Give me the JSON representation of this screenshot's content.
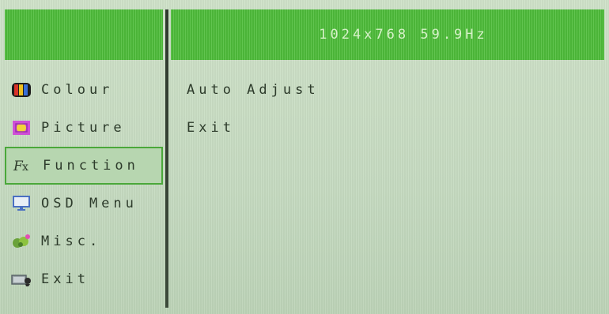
{
  "header": {
    "resolution": "1024x768 59.9Hz"
  },
  "menu": {
    "items": [
      {
        "label": "Colour",
        "icon": "colour-bars-icon"
      },
      {
        "label": "Picture",
        "icon": "picture-icon"
      },
      {
        "label": "Function",
        "icon": "function-fx-icon",
        "selected": true
      },
      {
        "label": "OSD Menu",
        "icon": "osd-monitor-icon"
      },
      {
        "label": "Misc.",
        "icon": "misc-icon"
      },
      {
        "label": "Exit",
        "icon": "exit-icon"
      }
    ]
  },
  "submenu": {
    "items": [
      {
        "label": "Auto Adjust"
      },
      {
        "label": "Exit"
      }
    ]
  },
  "colors": {
    "header_green": "#4fbe3b",
    "background": "#c9ddc4",
    "text": "#2d3b2b",
    "selected_border": "#4aa83a"
  }
}
